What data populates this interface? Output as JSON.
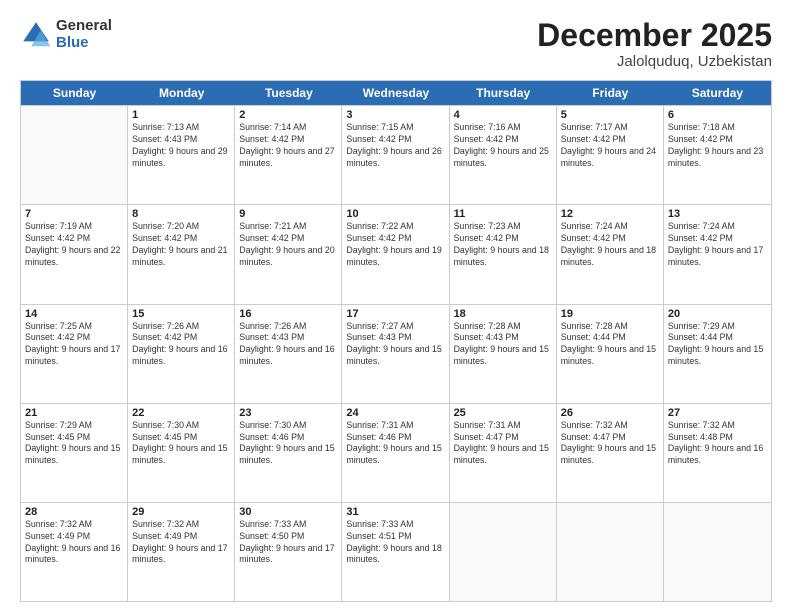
{
  "logo": {
    "general": "General",
    "blue": "Blue"
  },
  "header": {
    "month": "December 2025",
    "location": "Jalolquduq, Uzbekistan"
  },
  "weekdays": [
    "Sunday",
    "Monday",
    "Tuesday",
    "Wednesday",
    "Thursday",
    "Friday",
    "Saturday"
  ],
  "weeks": [
    [
      {
        "day": "",
        "empty": true
      },
      {
        "day": "1",
        "sunrise": "7:13 AM",
        "sunset": "4:43 PM",
        "daylight": "9 hours and 29 minutes."
      },
      {
        "day": "2",
        "sunrise": "7:14 AM",
        "sunset": "4:42 PM",
        "daylight": "9 hours and 27 minutes."
      },
      {
        "day": "3",
        "sunrise": "7:15 AM",
        "sunset": "4:42 PM",
        "daylight": "9 hours and 26 minutes."
      },
      {
        "day": "4",
        "sunrise": "7:16 AM",
        "sunset": "4:42 PM",
        "daylight": "9 hours and 25 minutes."
      },
      {
        "day": "5",
        "sunrise": "7:17 AM",
        "sunset": "4:42 PM",
        "daylight": "9 hours and 24 minutes."
      },
      {
        "day": "6",
        "sunrise": "7:18 AM",
        "sunset": "4:42 PM",
        "daylight": "9 hours and 23 minutes."
      }
    ],
    [
      {
        "day": "7",
        "sunrise": "7:19 AM",
        "sunset": "4:42 PM",
        "daylight": "9 hours and 22 minutes."
      },
      {
        "day": "8",
        "sunrise": "7:20 AM",
        "sunset": "4:42 PM",
        "daylight": "9 hours and 21 minutes."
      },
      {
        "day": "9",
        "sunrise": "7:21 AM",
        "sunset": "4:42 PM",
        "daylight": "9 hours and 20 minutes."
      },
      {
        "day": "10",
        "sunrise": "7:22 AM",
        "sunset": "4:42 PM",
        "daylight": "9 hours and 19 minutes."
      },
      {
        "day": "11",
        "sunrise": "7:23 AM",
        "sunset": "4:42 PM",
        "daylight": "9 hours and 18 minutes."
      },
      {
        "day": "12",
        "sunrise": "7:24 AM",
        "sunset": "4:42 PM",
        "daylight": "9 hours and 18 minutes."
      },
      {
        "day": "13",
        "sunrise": "7:24 AM",
        "sunset": "4:42 PM",
        "daylight": "9 hours and 17 minutes."
      }
    ],
    [
      {
        "day": "14",
        "sunrise": "7:25 AM",
        "sunset": "4:42 PM",
        "daylight": "9 hours and 17 minutes."
      },
      {
        "day": "15",
        "sunrise": "7:26 AM",
        "sunset": "4:42 PM",
        "daylight": "9 hours and 16 minutes."
      },
      {
        "day": "16",
        "sunrise": "7:26 AM",
        "sunset": "4:43 PM",
        "daylight": "9 hours and 16 minutes."
      },
      {
        "day": "17",
        "sunrise": "7:27 AM",
        "sunset": "4:43 PM",
        "daylight": "9 hours and 15 minutes."
      },
      {
        "day": "18",
        "sunrise": "7:28 AM",
        "sunset": "4:43 PM",
        "daylight": "9 hours and 15 minutes."
      },
      {
        "day": "19",
        "sunrise": "7:28 AM",
        "sunset": "4:44 PM",
        "daylight": "9 hours and 15 minutes."
      },
      {
        "day": "20",
        "sunrise": "7:29 AM",
        "sunset": "4:44 PM",
        "daylight": "9 hours and 15 minutes."
      }
    ],
    [
      {
        "day": "21",
        "sunrise": "7:29 AM",
        "sunset": "4:45 PM",
        "daylight": "9 hours and 15 minutes."
      },
      {
        "day": "22",
        "sunrise": "7:30 AM",
        "sunset": "4:45 PM",
        "daylight": "9 hours and 15 minutes."
      },
      {
        "day": "23",
        "sunrise": "7:30 AM",
        "sunset": "4:46 PM",
        "daylight": "9 hours and 15 minutes."
      },
      {
        "day": "24",
        "sunrise": "7:31 AM",
        "sunset": "4:46 PM",
        "daylight": "9 hours and 15 minutes."
      },
      {
        "day": "25",
        "sunrise": "7:31 AM",
        "sunset": "4:47 PM",
        "daylight": "9 hours and 15 minutes."
      },
      {
        "day": "26",
        "sunrise": "7:32 AM",
        "sunset": "4:47 PM",
        "daylight": "9 hours and 15 minutes."
      },
      {
        "day": "27",
        "sunrise": "7:32 AM",
        "sunset": "4:48 PM",
        "daylight": "9 hours and 16 minutes."
      }
    ],
    [
      {
        "day": "28",
        "sunrise": "7:32 AM",
        "sunset": "4:49 PM",
        "daylight": "9 hours and 16 minutes."
      },
      {
        "day": "29",
        "sunrise": "7:32 AM",
        "sunset": "4:49 PM",
        "daylight": "9 hours and 17 minutes."
      },
      {
        "day": "30",
        "sunrise": "7:33 AM",
        "sunset": "4:50 PM",
        "daylight": "9 hours and 17 minutes."
      },
      {
        "day": "31",
        "sunrise": "7:33 AM",
        "sunset": "4:51 PM",
        "daylight": "9 hours and 18 minutes."
      },
      {
        "day": "",
        "empty": true
      },
      {
        "day": "",
        "empty": true
      },
      {
        "day": "",
        "empty": true
      }
    ]
  ]
}
